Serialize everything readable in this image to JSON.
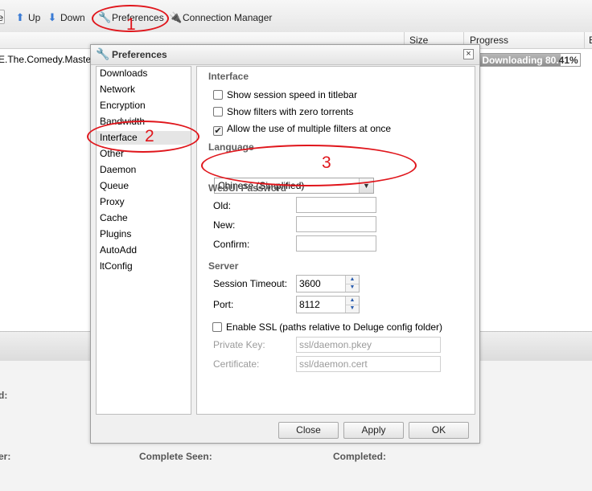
{
  "toolbar": {
    "edge_glyph": "e",
    "up_label": "Up",
    "down_label": "Down",
    "preferences_label": "Preferences",
    "connection_manager_label": "Connection Manager"
  },
  "torrent_list": {
    "columns": {
      "size": "Size",
      "progress": "Progress",
      "next": "E"
    },
    "rows": [
      {
        "name": "E.The.Comedy.Maste",
        "progress_text": "Downloading 80.",
        "progress_suffix": "41%",
        "progress_percent": 80.41
      }
    ]
  },
  "details": {
    "left_d": "d:",
    "left_er": "er:",
    "complete_seen": "Complete Seen:",
    "completed": "Completed:"
  },
  "dialog": {
    "title": "Preferences",
    "close_glyph": "×",
    "nav_items": [
      "Downloads",
      "Network",
      "Encryption",
      "Bandwidth",
      "Interface",
      "Other",
      "Daemon",
      "Queue",
      "Proxy",
      "Cache",
      "Plugins",
      "AutoAdd",
      "ltConfig"
    ],
    "selected_nav": "Interface",
    "interface": {
      "section_title": "Interface",
      "options": [
        {
          "label": "Show session speed in titlebar",
          "checked": false
        },
        {
          "label": "Show filters with zero torrents",
          "checked": false
        },
        {
          "label": "Allow the use of multiple filters at once",
          "checked": true
        }
      ]
    },
    "language": {
      "section_title": "Language",
      "selected": "Chinese (Simplified)"
    },
    "webui_password": {
      "section_title": "WebUI Password",
      "old_label": "Old:",
      "new_label": "New:",
      "confirm_label": "Confirm:",
      "old_value": "",
      "new_value": "",
      "confirm_value": ""
    },
    "server": {
      "section_title": "Server",
      "session_timeout_label": "Session Timeout:",
      "session_timeout_value": "3600",
      "port_label": "Port:",
      "port_value": "8112",
      "ssl_label": "Enable SSL (paths relative to Deluge config folder)",
      "ssl_checked": false,
      "private_key_label": "Private Key:",
      "private_key_value": "ssl/daemon.pkey",
      "certificate_label": "Certificate:",
      "certificate_value": "ssl/daemon.cert"
    },
    "buttons": {
      "close": "Close",
      "apply": "Apply",
      "ok": "OK"
    }
  },
  "annotations": {
    "n1": "1",
    "n2": "2",
    "n3": "3",
    "color": "#e0161c"
  }
}
